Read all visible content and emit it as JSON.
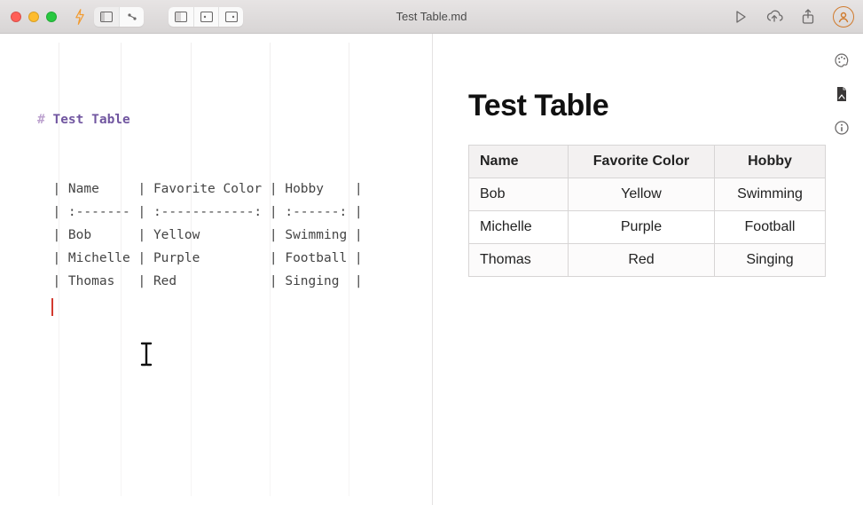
{
  "window": {
    "title": "Test Table.md"
  },
  "editor": {
    "heading_prefix": "#",
    "heading_text": "Test Table",
    "lines": [
      "  | Name     | Favorite Color | Hobby    |",
      "  | :------- | :------------: | :------: |",
      "  | Bob      | Yellow         | Swimming |",
      "  | Michelle | Purple         | Football |",
      "  | Thomas   | Red            | Singing  |"
    ]
  },
  "preview": {
    "title": "Test Table"
  },
  "chart_data": {
    "type": "table",
    "columns": [
      "Name",
      "Favorite Color",
      "Hobby"
    ],
    "rows": [
      [
        "Bob",
        "Yellow",
        "Swimming"
      ],
      [
        "Michelle",
        "Purple",
        "Football"
      ],
      [
        "Thomas",
        "Red",
        "Singing"
      ]
    ],
    "align": [
      "left",
      "center",
      "center"
    ]
  },
  "icons": {
    "bolt": "bolt-icon",
    "panel": "sidebar-panel-icon",
    "layout": "split-layout-icon",
    "play": "play-icon",
    "cloud": "cloud-upload-icon",
    "share": "share-icon",
    "palette": "palette-icon",
    "pdf": "pdf-icon",
    "info": "info-icon",
    "avatar": "user-avatar"
  }
}
